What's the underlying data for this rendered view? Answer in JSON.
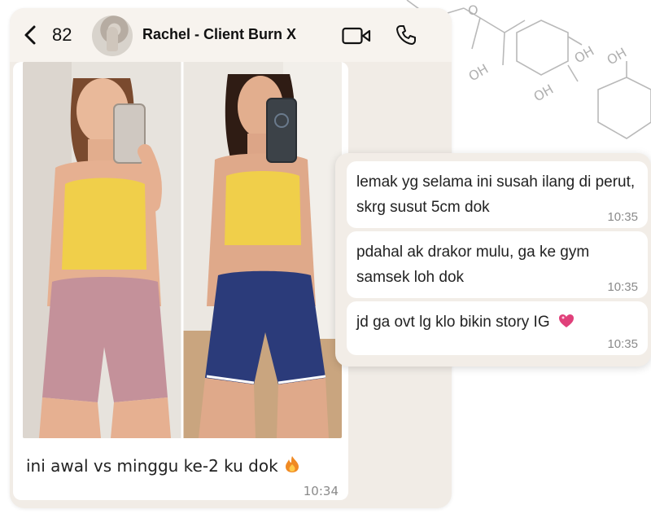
{
  "header": {
    "unread_count": "82",
    "contact_name": "Rachel - Client Burn X"
  },
  "icons": {
    "back": "chevron-left-icon",
    "video": "video-camera-icon",
    "call": "phone-icon",
    "fire": "fire-emoji",
    "heart": "sparkling-heart-emoji"
  },
  "image_message": {
    "caption": "ini awal vs minggu ke-2 ku dok",
    "time": "10:34"
  },
  "text_messages": [
    {
      "text": "lemak yg selama ini susah ilang di perut, skrg susut 5cm dok",
      "time": "10:35"
    },
    {
      "text": "pdahal ak drakor mulu, ga ke gym samsek loh dok",
      "time": "10:35"
    },
    {
      "text": "jd ga ovt lg klo bikin story IG",
      "time": "10:35"
    }
  ],
  "molecule_labels": [
    "O",
    "OH",
    "OH",
    "OH",
    "OH"
  ],
  "colors": {
    "chat_background": "#f1ece6",
    "bubble": "#ffffff",
    "timestamp": "#8a8a8a",
    "heart": "#e0407a",
    "fire": "#f08a24"
  }
}
